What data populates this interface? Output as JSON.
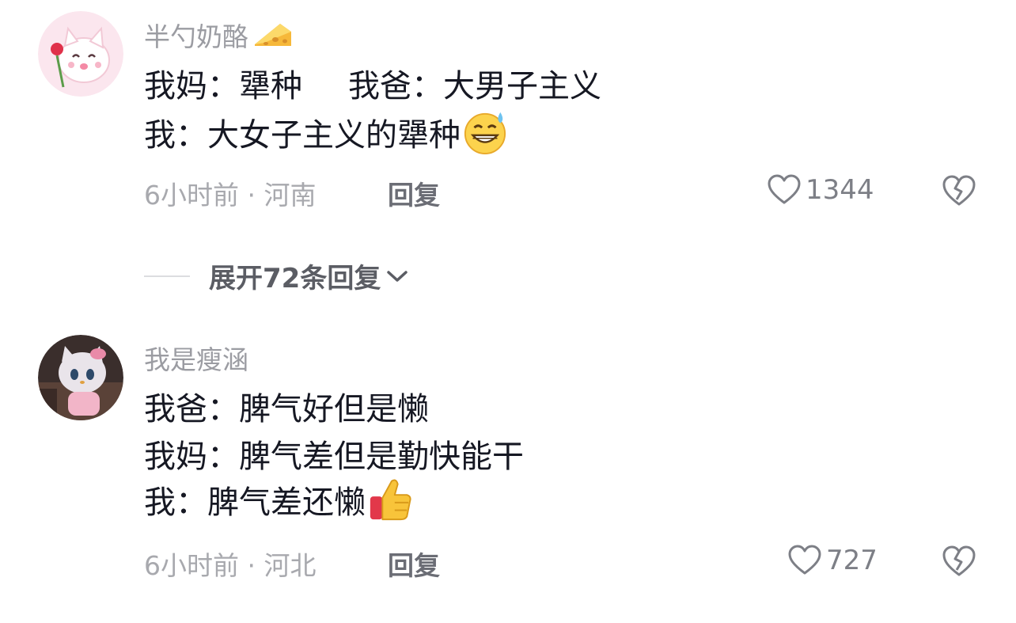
{
  "comments": [
    {
      "username": "半勺奶酪",
      "username_emoji": "cheese-icon",
      "lines": [
        {
          "parts": [
            "我妈：犟种",
            "我爸：大男子主义"
          ]
        },
        {
          "parts": [
            "我：大女子主义的犟种"
          ],
          "emoji": "grinning-sweat-emoji"
        }
      ],
      "time": "6小时前",
      "location": "河南",
      "reply_label": "回复",
      "likes": "1344"
    },
    {
      "username": "我是瘦涵",
      "lines": [
        {
          "parts": [
            "我爸：脾气好但是懒"
          ]
        },
        {
          "parts": [
            "我妈：脾气差但是勤快能干"
          ]
        },
        {
          "parts": [
            "我：脾气差还懒"
          ],
          "emoji": "thumbs-up-emoji"
        }
      ],
      "time": "6小时前",
      "location": "河北",
      "reply_label": "回复",
      "likes": "727"
    }
  ],
  "expand_replies": {
    "label": "展开72条回复"
  },
  "colors": {
    "username": "#9b9ca2",
    "text": "#161823",
    "meta": "#a8a9ae"
  }
}
